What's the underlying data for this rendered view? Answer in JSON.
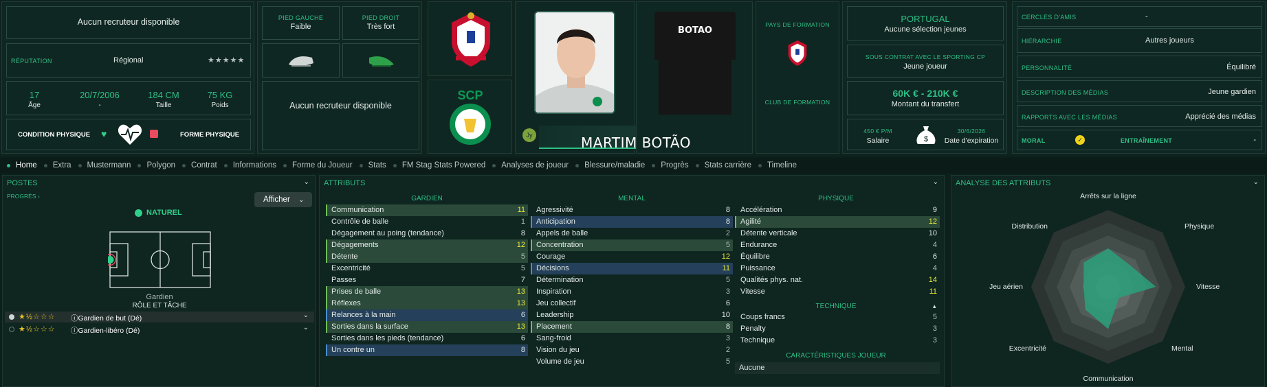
{
  "top": {
    "recruiter1": "Aucun recruteur disponible",
    "reputation_label": "RÉPUTATION",
    "reputation_value": "Régional",
    "reputation_stars": "★★★★★",
    "age": "17",
    "age_label": "Âge",
    "dob": "20/7/2006",
    "dob_label": "-",
    "height": "184 CM",
    "height_label": "Taille",
    "weight": "75 KG",
    "weight_label": "Poids",
    "condition_label": "CONDITION PHYSIQUE",
    "form_label": "FORME PHYSIQUE",
    "left_foot_label": "PIED GAUCHE",
    "left_foot_value": "Faible",
    "right_foot_label": "PIED DROIT",
    "right_foot_value": "Très fort",
    "recruiter2": "Aucun recruteur disponible",
    "shirt_name": "BOTAO",
    "player_name": "MARTIM BOTÃO",
    "jersey_badge": "Jy",
    "formation_country_label": "PAYS DE FORMATION",
    "formation_club_label": "CLUB DE FORMATION",
    "nation": "PORTUGAL",
    "nation_sub": "Aucune sélection jeunes",
    "contract_label": "SOUS CONTRAT AVEC LE SPORTING CP",
    "contract_value": "Jeune joueur",
    "transfer_value": "60K € - 210K €",
    "transfer_label": "Montant du transfert",
    "salary_value": "450 € P/M",
    "salary_label": "Salaire",
    "expiry_value": "30/6/2026",
    "expiry_label": "Date d'expiration",
    "friends_label": "CERCLES D'AMIS",
    "friends_value": "-",
    "hierarchy_label": "HIÉRARCHIE",
    "hierarchy_value": "Autres joueurs",
    "personality_label": "PERSONNALITÉ",
    "personality_value": "Équilibré",
    "media_desc_label": "DESCRIPTION DES MÉDIAS",
    "media_desc_value": "Jeune gardien",
    "media_rel_label": "RAPPORTS AVEC LES MÉDIAS",
    "media_rel_value": "Apprécié des médias",
    "morale_label": "MORAL",
    "training_label": "ENTRAÎNEMENT",
    "training_value": "-"
  },
  "nav": [
    "Home",
    "Extra",
    "Mustermann",
    "Polygon",
    "Contrat",
    "Informations",
    "Forme du Joueur",
    "Stats",
    "FM Stag Stats Powered",
    "Analyses de joueur",
    "Blessure/maladie",
    "Progrès",
    "Stats carrière",
    "Timeline"
  ],
  "positions": {
    "title": "POSTES",
    "progress": "PROGRÈS",
    "show_button": "Afficher",
    "natural": "NATUREL",
    "position_name": "Gardien",
    "role_label": "RÔLE ET TÂCHE",
    "roles": [
      {
        "name": "Gardien de but (Dé)",
        "stars": "★½☆☆☆"
      },
      {
        "name": "Gardien-libéro (Dé)",
        "stars": "★½☆☆☆"
      }
    ]
  },
  "attributes": {
    "title": "ATTRIBUTS",
    "gk_header": "GARDIEN",
    "mental_header": "MENTAL",
    "physical_header": "PHYSIQUE",
    "technical_header": "TECHNIQUE",
    "traits_header": "CARACTÉRISTIQUES JOUEUR",
    "traits_value": "Aucune",
    "gk": [
      {
        "n": "Communication",
        "v": "11",
        "h": "g",
        "c": "y"
      },
      {
        "n": "Contrôle de balle",
        "v": "1",
        "h": "",
        "c": "mut"
      },
      {
        "n": "Dégagement au poing (tendance)",
        "v": "8",
        "h": "",
        "c": ""
      },
      {
        "n": "Dégagements",
        "v": "12",
        "h": "g",
        "c": "y"
      },
      {
        "n": "Détente",
        "v": "5",
        "h": "g",
        "c": "mut"
      },
      {
        "n": "Excentricité",
        "v": "5",
        "h": "",
        "c": "mut"
      },
      {
        "n": "Passes",
        "v": "7",
        "h": "",
        "c": ""
      },
      {
        "n": "Prises de balle",
        "v": "13",
        "h": "g",
        "c": "y"
      },
      {
        "n": "Réflexes",
        "v": "13",
        "h": "g",
        "c": "y"
      },
      {
        "n": "Relances à la main",
        "v": "6",
        "h": "b",
        "c": ""
      },
      {
        "n": "Sorties dans la surface",
        "v": "13",
        "h": "g",
        "c": "y"
      },
      {
        "n": "Sorties dans les pieds (tendance)",
        "v": "6",
        "h": "",
        "c": ""
      },
      {
        "n": "Un contre un",
        "v": "8",
        "h": "b",
        "c": ""
      }
    ],
    "mental": [
      {
        "n": "Agressivité",
        "v": "8",
        "h": "",
        "c": ""
      },
      {
        "n": "Anticipation",
        "v": "8",
        "h": "b",
        "c": ""
      },
      {
        "n": "Appels de balle",
        "v": "2",
        "h": "",
        "c": "mut"
      },
      {
        "n": "Concentration",
        "v": "5",
        "h": "g",
        "c": "mut"
      },
      {
        "n": "Courage",
        "v": "12",
        "h": "",
        "c": "y"
      },
      {
        "n": "Décisions",
        "v": "11",
        "h": "b",
        "c": "y"
      },
      {
        "n": "Détermination",
        "v": "5",
        "h": "",
        "c": "mut"
      },
      {
        "n": "Inspiration",
        "v": "3",
        "h": "",
        "c": "mut"
      },
      {
        "n": "Jeu collectif",
        "v": "6",
        "h": "",
        "c": ""
      },
      {
        "n": "Leadership",
        "v": "10",
        "h": "",
        "c": ""
      },
      {
        "n": "Placement",
        "v": "8",
        "h": "g",
        "c": ""
      },
      {
        "n": "Sang-froid",
        "v": "3",
        "h": "",
        "c": "mut"
      },
      {
        "n": "Vision du jeu",
        "v": "2",
        "h": "",
        "c": "mut"
      },
      {
        "n": "Volume de jeu",
        "v": "5",
        "h": "",
        "c": "mut"
      }
    ],
    "physical": [
      {
        "n": "Accélération",
        "v": "9",
        "h": "",
        "c": ""
      },
      {
        "n": "Agilité",
        "v": "12",
        "h": "g",
        "c": "y"
      },
      {
        "n": "Détente verticale",
        "v": "10",
        "h": "",
        "c": ""
      },
      {
        "n": "Endurance",
        "v": "4",
        "h": "",
        "c": "mut"
      },
      {
        "n": "Équilibre",
        "v": "6",
        "h": "",
        "c": ""
      },
      {
        "n": "Puissance",
        "v": "4",
        "h": "",
        "c": "mut"
      },
      {
        "n": "Qualités phys. nat.",
        "v": "14",
        "h": "",
        "c": "y"
      },
      {
        "n": "Vitesse",
        "v": "11",
        "h": "",
        "c": "y"
      }
    ],
    "technical": [
      {
        "n": "Coups francs",
        "v": "5",
        "h": "",
        "c": "mut"
      },
      {
        "n": "Penalty",
        "v": "3",
        "h": "",
        "c": "mut"
      },
      {
        "n": "Technique",
        "v": "3",
        "h": "",
        "c": "mut"
      }
    ]
  },
  "analysis": {
    "title": "ANALYSE DES ATTRIBUTS",
    "axes": [
      "Arrêts sur la ligne",
      "Physique",
      "Vitesse",
      "Mental",
      "Communication",
      "Excentricité",
      "Jeu aérien",
      "Distribution"
    ]
  }
}
